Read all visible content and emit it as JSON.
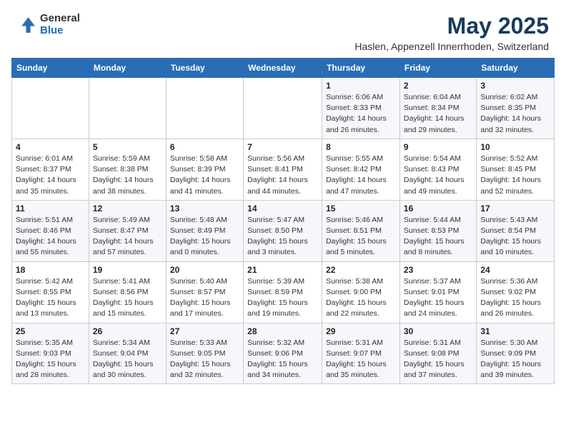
{
  "header": {
    "logo_general": "General",
    "logo_blue": "Blue",
    "month_title": "May 2025",
    "subtitle": "Haslen, Appenzell Innerrhoden, Switzerland"
  },
  "weekdays": [
    "Sunday",
    "Monday",
    "Tuesday",
    "Wednesday",
    "Thursday",
    "Friday",
    "Saturday"
  ],
  "weeks": [
    [
      {
        "day": "",
        "info": ""
      },
      {
        "day": "",
        "info": ""
      },
      {
        "day": "",
        "info": ""
      },
      {
        "day": "",
        "info": ""
      },
      {
        "day": "1",
        "info": "Sunrise: 6:06 AM\nSunset: 8:33 PM\nDaylight: 14 hours\nand 26 minutes."
      },
      {
        "day": "2",
        "info": "Sunrise: 6:04 AM\nSunset: 8:34 PM\nDaylight: 14 hours\nand 29 minutes."
      },
      {
        "day": "3",
        "info": "Sunrise: 6:02 AM\nSunset: 8:35 PM\nDaylight: 14 hours\nand 32 minutes."
      }
    ],
    [
      {
        "day": "4",
        "info": "Sunrise: 6:01 AM\nSunset: 8:37 PM\nDaylight: 14 hours\nand 35 minutes."
      },
      {
        "day": "5",
        "info": "Sunrise: 5:59 AM\nSunset: 8:38 PM\nDaylight: 14 hours\nand 38 minutes."
      },
      {
        "day": "6",
        "info": "Sunrise: 5:58 AM\nSunset: 8:39 PM\nDaylight: 14 hours\nand 41 minutes."
      },
      {
        "day": "7",
        "info": "Sunrise: 5:56 AM\nSunset: 8:41 PM\nDaylight: 14 hours\nand 44 minutes."
      },
      {
        "day": "8",
        "info": "Sunrise: 5:55 AM\nSunset: 8:42 PM\nDaylight: 14 hours\nand 47 minutes."
      },
      {
        "day": "9",
        "info": "Sunrise: 5:54 AM\nSunset: 8:43 PM\nDaylight: 14 hours\nand 49 minutes."
      },
      {
        "day": "10",
        "info": "Sunrise: 5:52 AM\nSunset: 8:45 PM\nDaylight: 14 hours\nand 52 minutes."
      }
    ],
    [
      {
        "day": "11",
        "info": "Sunrise: 5:51 AM\nSunset: 8:46 PM\nDaylight: 14 hours\nand 55 minutes."
      },
      {
        "day": "12",
        "info": "Sunrise: 5:49 AM\nSunset: 8:47 PM\nDaylight: 14 hours\nand 57 minutes."
      },
      {
        "day": "13",
        "info": "Sunrise: 5:48 AM\nSunset: 8:49 PM\nDaylight: 15 hours\nand 0 minutes."
      },
      {
        "day": "14",
        "info": "Sunrise: 5:47 AM\nSunset: 8:50 PM\nDaylight: 15 hours\nand 3 minutes."
      },
      {
        "day": "15",
        "info": "Sunrise: 5:46 AM\nSunset: 8:51 PM\nDaylight: 15 hours\nand 5 minutes."
      },
      {
        "day": "16",
        "info": "Sunrise: 5:44 AM\nSunset: 8:53 PM\nDaylight: 15 hours\nand 8 minutes."
      },
      {
        "day": "17",
        "info": "Sunrise: 5:43 AM\nSunset: 8:54 PM\nDaylight: 15 hours\nand 10 minutes."
      }
    ],
    [
      {
        "day": "18",
        "info": "Sunrise: 5:42 AM\nSunset: 8:55 PM\nDaylight: 15 hours\nand 13 minutes."
      },
      {
        "day": "19",
        "info": "Sunrise: 5:41 AM\nSunset: 8:56 PM\nDaylight: 15 hours\nand 15 minutes."
      },
      {
        "day": "20",
        "info": "Sunrise: 5:40 AM\nSunset: 8:57 PM\nDaylight: 15 hours\nand 17 minutes."
      },
      {
        "day": "21",
        "info": "Sunrise: 5:39 AM\nSunset: 8:59 PM\nDaylight: 15 hours\nand 19 minutes."
      },
      {
        "day": "22",
        "info": "Sunrise: 5:38 AM\nSunset: 9:00 PM\nDaylight: 15 hours\nand 22 minutes."
      },
      {
        "day": "23",
        "info": "Sunrise: 5:37 AM\nSunset: 9:01 PM\nDaylight: 15 hours\nand 24 minutes."
      },
      {
        "day": "24",
        "info": "Sunrise: 5:36 AM\nSunset: 9:02 PM\nDaylight: 15 hours\nand 26 minutes."
      }
    ],
    [
      {
        "day": "25",
        "info": "Sunrise: 5:35 AM\nSunset: 9:03 PM\nDaylight: 15 hours\nand 28 minutes."
      },
      {
        "day": "26",
        "info": "Sunrise: 5:34 AM\nSunset: 9:04 PM\nDaylight: 15 hours\nand 30 minutes."
      },
      {
        "day": "27",
        "info": "Sunrise: 5:33 AM\nSunset: 9:05 PM\nDaylight: 15 hours\nand 32 minutes."
      },
      {
        "day": "28",
        "info": "Sunrise: 5:32 AM\nSunset: 9:06 PM\nDaylight: 15 hours\nand 34 minutes."
      },
      {
        "day": "29",
        "info": "Sunrise: 5:31 AM\nSunset: 9:07 PM\nDaylight: 15 hours\nand 35 minutes."
      },
      {
        "day": "30",
        "info": "Sunrise: 5:31 AM\nSunset: 9:08 PM\nDaylight: 15 hours\nand 37 minutes."
      },
      {
        "day": "31",
        "info": "Sunrise: 5:30 AM\nSunset: 9:09 PM\nDaylight: 15 hours\nand 39 minutes."
      }
    ]
  ]
}
